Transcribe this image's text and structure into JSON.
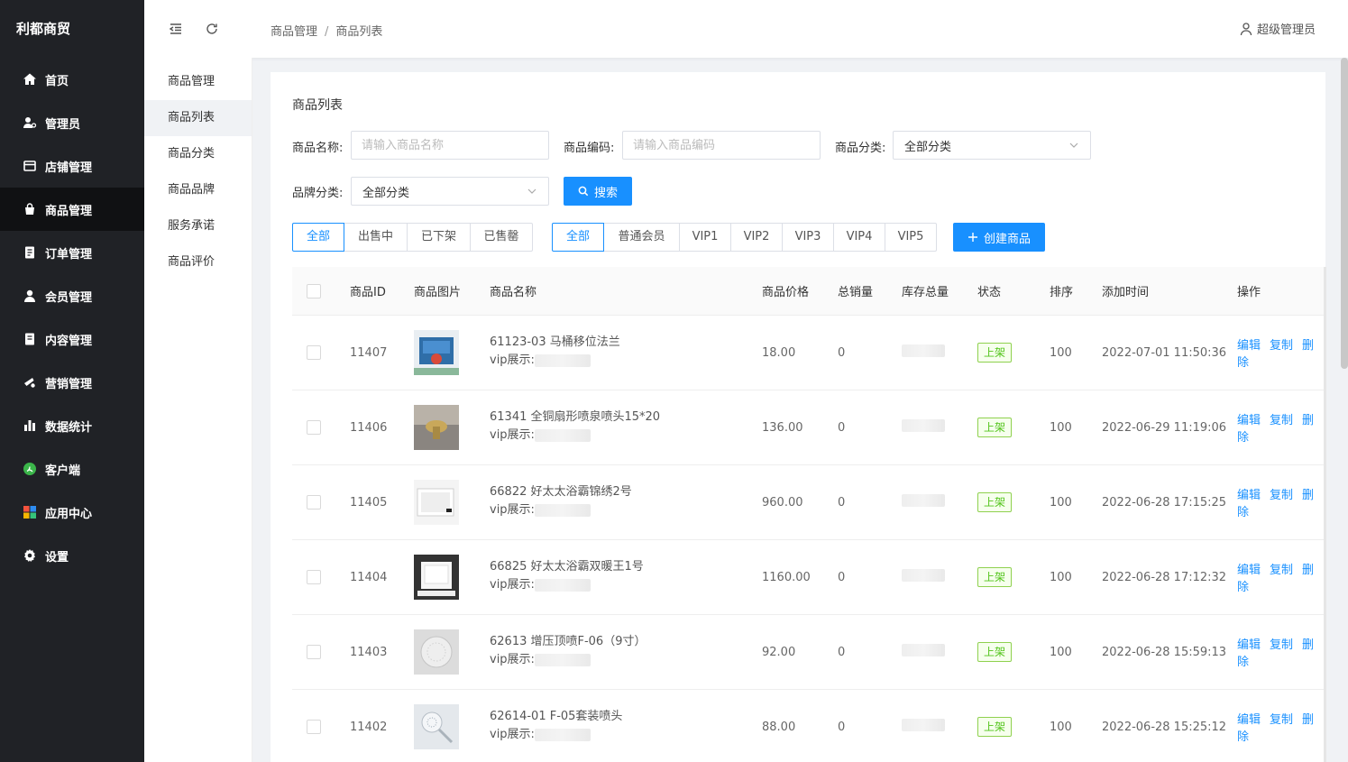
{
  "brand": "利都商贸",
  "nav": [
    {
      "label": "首页",
      "icon": "home-icon",
      "key": "home"
    },
    {
      "label": "管理员",
      "icon": "admin-icon",
      "key": "admin"
    },
    {
      "label": "店铺管理",
      "icon": "store-icon",
      "key": "store"
    },
    {
      "label": "商品管理",
      "icon": "shopping-bag-icon",
      "key": "goods"
    },
    {
      "label": "订单管理",
      "icon": "order-icon",
      "key": "order"
    },
    {
      "label": "会员管理",
      "icon": "member-icon",
      "key": "member"
    },
    {
      "label": "内容管理",
      "icon": "content-icon",
      "key": "content"
    },
    {
      "label": "营销管理",
      "icon": "marketing-icon",
      "key": "marketing"
    },
    {
      "label": "数据统计",
      "icon": "bar-chart-icon",
      "key": "stats"
    },
    {
      "label": "客户端",
      "icon": "client-icon",
      "key": "client"
    },
    {
      "label": "应用中心",
      "icon": "apps-icon",
      "key": "apps"
    },
    {
      "label": "设置",
      "icon": "gear-icon",
      "key": "settings"
    }
  ],
  "subnav": [
    "商品管理",
    "商品列表",
    "商品分类",
    "商品品牌",
    "服务承诺",
    "商品评价"
  ],
  "breadcrumb": {
    "root": "商品管理",
    "sep": "/",
    "current": "商品列表"
  },
  "user": {
    "name": "超级管理员"
  },
  "card_title": "商品列表",
  "filters": {
    "name_label": "商品名称:",
    "name_placeholder": "请输入商品名称",
    "code_label": "商品编码:",
    "code_placeholder": "请输入商品编码",
    "category_label": "商品分类:",
    "category_value": "全部分类",
    "brand_label": "品牌分类:",
    "brand_value": "全部分类",
    "search_label": "搜索"
  },
  "status_tabs": [
    "全部",
    "出售中",
    "已下架",
    "已售罄"
  ],
  "member_tabs": [
    "全部",
    "普通会员",
    "VIP1",
    "VIP2",
    "VIP3",
    "VIP4",
    "VIP5"
  ],
  "create_label": "创建商品",
  "table": {
    "headers": {
      "id": "商品ID",
      "img": "商品图片",
      "name": "商品名称",
      "price": "商品价格",
      "sales": "总销量",
      "stock": "库存总量",
      "status": "状态",
      "sort": "排序",
      "time": "添加时间",
      "ops": "操作"
    },
    "vip_prefix": "vip展示:",
    "ops": [
      "编辑",
      "复制",
      "删除"
    ],
    "rows": [
      {
        "id": "11407",
        "name": "61123-03 马桶移位法兰",
        "price": "18.00",
        "sales": "0",
        "status": "上架",
        "sort": "100",
        "time": "2022-07-01 11:50:36",
        "thumb": "flange"
      },
      {
        "id": "11406",
        "name": "61341 全铜扇形喷泉喷头15*20",
        "price": "136.00",
        "sales": "0",
        "status": "上架",
        "sort": "100",
        "time": "2022-06-29 11:19:06",
        "thumb": "brass"
      },
      {
        "id": "11405",
        "name": "66822 好太太浴霸锦绣2号",
        "price": "960.00",
        "sales": "0",
        "status": "上架",
        "sort": "100",
        "time": "2022-06-28 17:15:25",
        "thumb": "heater"
      },
      {
        "id": "11404",
        "name": "66825 好太太浴霸双暖王1号",
        "price": "1160.00",
        "sales": "0",
        "status": "上架",
        "sort": "100",
        "time": "2022-06-28 17:12:32",
        "thumb": "heater2"
      },
      {
        "id": "11403",
        "name": "62613 增压顶喷F-06（9寸）",
        "price": "92.00",
        "sales": "0",
        "status": "上架",
        "sort": "100",
        "time": "2022-06-28 15:59:13",
        "thumb": "shower"
      },
      {
        "id": "11402",
        "name": "62614-01 F-05套装喷头",
        "price": "88.00",
        "sales": "0",
        "status": "上架",
        "sort": "100",
        "time": "2022-06-28 15:25:12",
        "thumb": "showerset"
      }
    ]
  }
}
